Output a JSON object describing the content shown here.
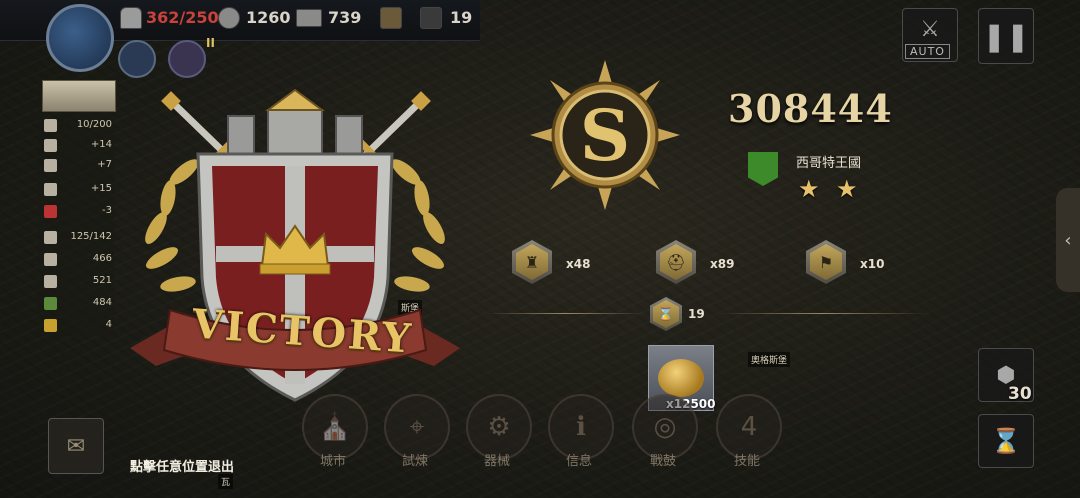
{
  "top_bar": {
    "troops": "362/250",
    "silver": "1260",
    "iron": "739",
    "hourglass": "19",
    "rank_numeral": "II"
  },
  "left_panel": {
    "rows": [
      "10/200",
      "+14",
      "+7",
      "+15",
      "-3",
      "125/142",
      "466",
      "521",
      "484",
      "4"
    ]
  },
  "victory": {
    "banner_text": "VICTORY"
  },
  "result": {
    "score": "308444",
    "nation": "西哥特王國",
    "stars": 2,
    "star_glyph": "★"
  },
  "rewards": {
    "items": [
      {
        "icon": "city-icon",
        "qty": "x48"
      },
      {
        "icon": "helmet-icon",
        "qty": "x89"
      },
      {
        "icon": "banner-icon",
        "qty": "x10"
      }
    ],
    "hourglass_qty": "19",
    "gold_qty": "x12500"
  },
  "bottom_nav": {
    "items": [
      "城市",
      "試煉",
      "器械",
      "信息",
      "戰鼓",
      "技能"
    ],
    "skill_badge": "4"
  },
  "exit_hint": "點擊任意位置退出",
  "right_controls": {
    "auto_label": "AUTO",
    "hex_count": "30"
  },
  "map_labels": [
    "奧格斯堡",
    "斯堡",
    "瓦"
  ],
  "colors": {
    "gold": "#e6d4a4",
    "nation_green": "#3d8a2a",
    "shield_red": "#7a1f1f",
    "troops_red": "#c9433b"
  }
}
